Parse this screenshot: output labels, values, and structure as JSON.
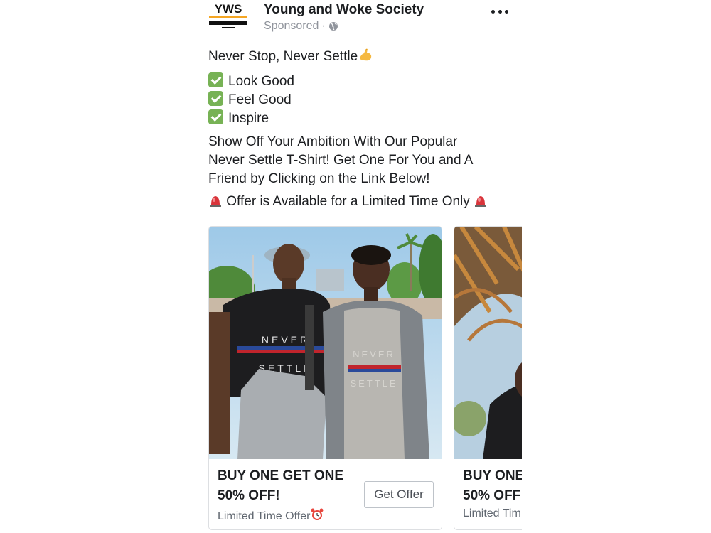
{
  "page": {
    "name": "Young and Woke Society",
    "sponsored": "Sponsored",
    "dot": "·",
    "logo_text": "YWS"
  },
  "post": {
    "headline": "Never Stop, Never Settle",
    "checklist": [
      "Look Good",
      "Feel Good",
      "Inspire"
    ],
    "body": "Show Off Your Ambition With Our Popular Never Settle T-Shirt! Get One For You and A Friend by Clicking on the Link Below!",
    "offer_line": "Offer is Available for a Limited Time Only"
  },
  "cards": [
    {
      "title_line1": "BUY ONE GET ONE",
      "title_line2": "50% OFF!",
      "subtitle": "Limited Time Offer",
      "cta": "Get Offer",
      "shirt_text_1": "NEVER",
      "shirt_text_2": "SETTLE"
    },
    {
      "title_line1": "BUY ONE",
      "title_line2": "50% OFF",
      "subtitle": "Limited Tim"
    }
  ],
  "icons": {
    "more": "more-options-icon",
    "globe": "globe-icon",
    "check": "check-mark-icon",
    "flex": "flexed-biceps-icon",
    "siren": "siren-icon",
    "clock": "alarm-clock-icon"
  },
  "colors": {
    "text": "#1c1e21",
    "muted": "#90949c",
    "check_green": "#77b255",
    "border": "#dddfe2",
    "accent_orange": "#f5a623"
  }
}
